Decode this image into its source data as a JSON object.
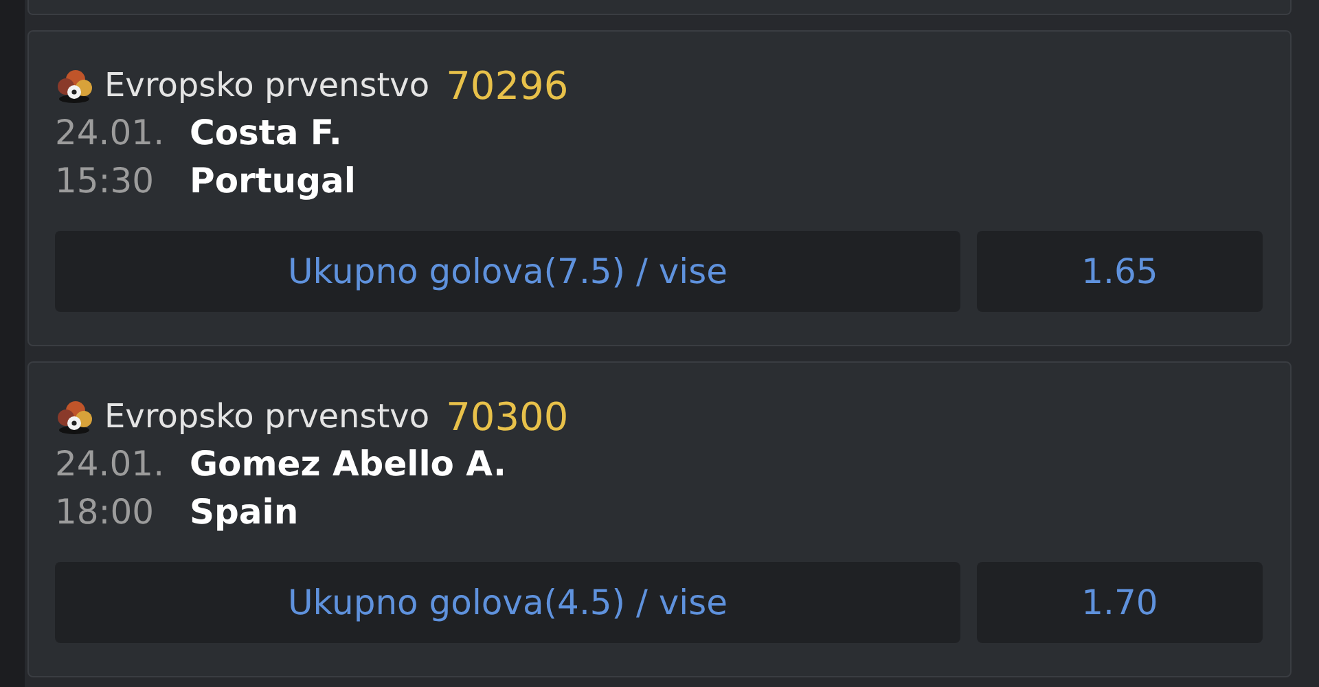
{
  "matches": [
    {
      "league": "Evropsko prvenstvo",
      "code": "70296",
      "date": "24.01.",
      "time": "15:30",
      "home": "Costa F.",
      "away": "Portugal",
      "market": "Ukupno golova(7.5) / vise",
      "odds": "1.65"
    },
    {
      "league": "Evropsko prvenstvo",
      "code": "70300",
      "date": "24.01.",
      "time": "18:00",
      "home": "Gomez Abello A.",
      "away": "Spain",
      "market": "Ukupno golova(4.5) / vise",
      "odds": "1.70"
    }
  ]
}
